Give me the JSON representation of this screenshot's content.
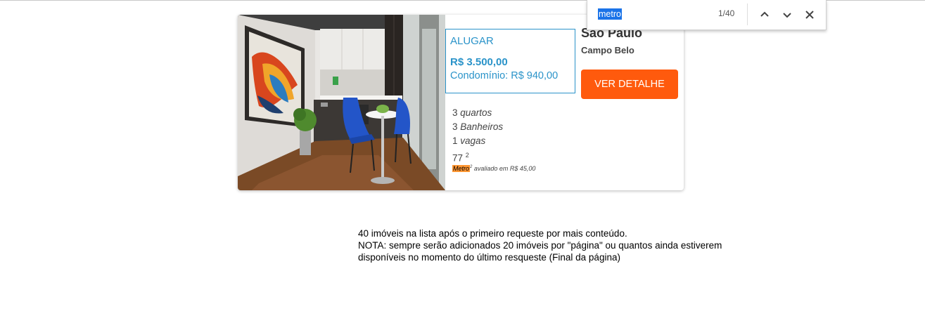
{
  "find_bar": {
    "query": "metro",
    "count": "1/40",
    "icons": [
      "chevron-up-icon",
      "chevron-down-icon",
      "close-icon"
    ]
  },
  "card": {
    "listing_type": "ALUGAR",
    "price": "R$ 3.500,00",
    "condo": "Condomínio: R$ 940,00",
    "city": "São Paulo",
    "neighborhood": "Campo Belo",
    "detail_button": "VER DETALHE",
    "features": {
      "bedrooms_num": "3",
      "bedrooms_label": "quartos",
      "bathrooms_num": "3",
      "bathrooms_label": "Banheiros",
      "parking_num": "1",
      "parking_label": "vagas",
      "area_num": "77",
      "area_sup": "2"
    },
    "metro_highlight": "Metro",
    "metro_sup": "2",
    "metro_text": " avaliado em R$ 45,00"
  },
  "note": "40 imóveis na lista após o primeiro requeste por mais conteúdo.\nNOTA: sempre serão adicionados 20 imóveis por \"página\" ou quantos ainda estiverem\ndisponíveis no momento do  último resqueste (Final da página)",
  "colors": {
    "accent_blue": "#2a93c9",
    "button_orange": "#ff5a0d",
    "find_highlight": "#ff9632",
    "find_selection": "#1a73e8"
  }
}
